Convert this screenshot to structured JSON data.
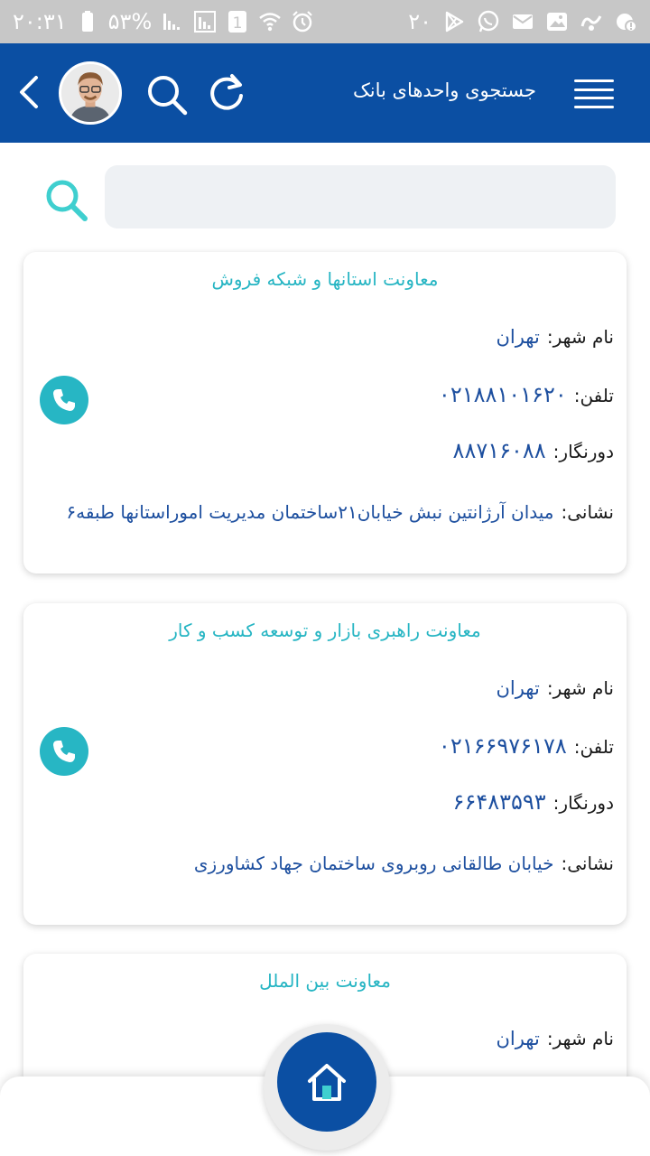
{
  "status_bar": {
    "time": "۲۰:۳۱",
    "battery": "۵۳%",
    "sim_badge": "1",
    "notification_count": "۲۰",
    "icons_left": [
      "battery-icon",
      "signal-icon",
      "signal-icon",
      "sim-icon",
      "wifi-icon",
      "alarm-icon"
    ],
    "icons_right": [
      "play-store-icon",
      "whatsapp-icon",
      "mail-icon",
      "gallery-icon",
      "app-icon",
      "notification-icon"
    ]
  },
  "header": {
    "title": "جستجوی واحدهای بانک",
    "background": "#0b4fa3"
  },
  "search": {
    "placeholder": "",
    "value": ""
  },
  "labels": {
    "city": "نام شهر:",
    "phone": "تلفن:",
    "fax": "دورنگار:",
    "address": "نشانی:"
  },
  "units": [
    {
      "title": "معاونت استانها و شبکه فروش",
      "city": "تهران",
      "phone": "۰۲۱۸۸۱۰۱۶۲۰",
      "fax": "۸۸۷۱۶۰۸۸",
      "address": "میدان    آرژانتین نبش خیابان۲۱ساختمان مدیریت  اموراستانها طبقه۶"
    },
    {
      "title": "معاونت راهبری بازار و توسعه کسب و کار",
      "city": "تهران",
      "phone": "۰۲۱۶۶۹۷۶۱۷۸",
      "fax": "۶۶۴۸۳۵۹۳",
      "address": "خیابان طالقانی روبروی ساختمان جهاد کشاورزی"
    },
    {
      "title": "معاونت بین الملل",
      "city": "تهران"
    }
  ],
  "colors": {
    "accent": "#26b5c3",
    "value_text": "#1d4f9f",
    "primary": "#0b4fa3"
  }
}
